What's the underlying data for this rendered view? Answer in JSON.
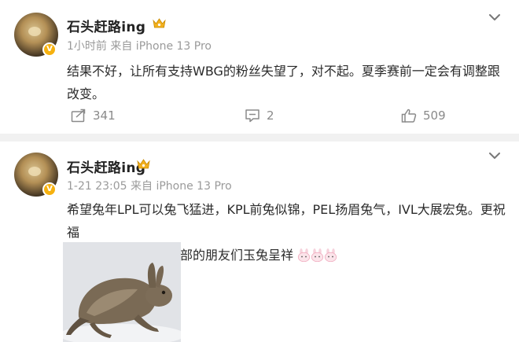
{
  "posts": [
    {
      "username": "石头赶路ing",
      "verified_badge": "V",
      "meta": "1小时前 来自 iPhone 13 Pro",
      "text": "结果不好，让所有支持WBG的粉丝失望了，对不起。夏季赛前一定会有调整跟改变。",
      "actions": {
        "repost": "341",
        "comment": "2",
        "like": "509"
      }
    },
    {
      "username": "石头赶路ing",
      "verified_badge": "V",
      "meta": "1-21 23:05 来自 iPhone 13 Pro",
      "text_line1": "希望兔年LPL可以兔飞猛进，KPL前兔似锦，PEL扬眉兔气，IVL大展宏兔。更祝福",
      "text_line2": "所有支持我们各个分部的朋友们玉兔呈祥"
    }
  ],
  "colors": {
    "badge": "#f6b10f",
    "meta_text": "#9a9a9a",
    "separator": "#f1f1f1"
  },
  "icons": [
    "chevron-down-icon",
    "crown-icon",
    "repost-icon",
    "comment-icon",
    "like-icon",
    "rabbit-emoji-icon"
  ]
}
